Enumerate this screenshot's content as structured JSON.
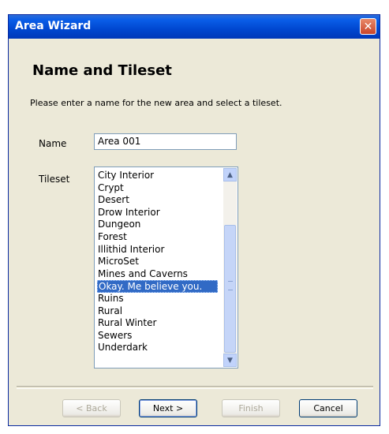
{
  "window": {
    "title": "Area Wizard",
    "close_icon": "close-icon"
  },
  "page": {
    "heading": "Name and Tileset",
    "instructions": "Please enter a name for the new area and select a tileset."
  },
  "name_field": {
    "label": "Name",
    "value": "Area 001"
  },
  "tileset": {
    "label": "Tileset",
    "items": [
      "City Interior",
      "Crypt",
      "Desert",
      "Drow Interior",
      "Dungeon",
      "Forest",
      "Illithid Interior",
      "MicroSet",
      "Mines and Caverns",
      "Okay. Me believe you.",
      "Ruins",
      "Rural",
      "Rural Winter",
      "Sewers",
      "Underdark"
    ],
    "selected": "Okay. Me believe you."
  },
  "buttons": {
    "back": "< Back",
    "next": "Next >",
    "finish": "Finish",
    "cancel": "Cancel"
  }
}
